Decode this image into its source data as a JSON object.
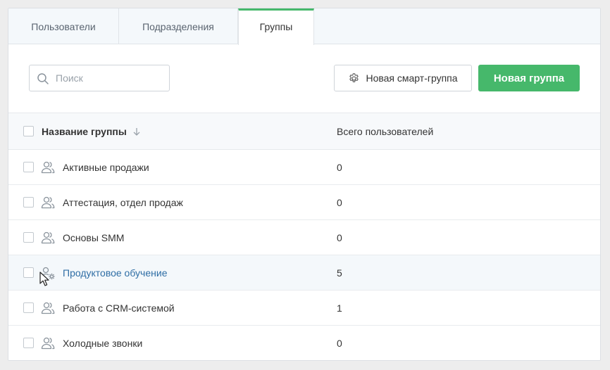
{
  "tabs": [
    {
      "label": "Пользователи"
    },
    {
      "label": "Подразделения"
    },
    {
      "label": "Группы"
    }
  ],
  "active_tab": "Группы",
  "accent_color": "#46b86b",
  "link_color": "#2f6ea5",
  "search": {
    "placeholder": "Поиск",
    "value": "",
    "icon": "search-icon"
  },
  "toolbar": {
    "smart_group_label": "Новая смарт-группа",
    "smart_group_icon": "gear-icon",
    "new_group_label": "Новая группа"
  },
  "table": {
    "columns": [
      "Название группы",
      "Всего пользователей"
    ],
    "sort_icon": "arrow-down-icon",
    "rows": [
      {
        "name": "Активные продажи",
        "count": "0",
        "icon": "users-icon"
      },
      {
        "name": "Аттестация, отдел продаж",
        "count": "0",
        "icon": "users-icon"
      },
      {
        "name": "Основы SMM",
        "count": "0",
        "icon": "users-icon"
      },
      {
        "name": "Продуктовое обучение",
        "count": "5",
        "icon": "users-gear-icon"
      },
      {
        "name": "Работа с CRM-системой",
        "count": "1",
        "icon": "users-icon"
      },
      {
        "name": "Холодные звонки",
        "count": "0",
        "icon": "users-icon"
      }
    ]
  }
}
